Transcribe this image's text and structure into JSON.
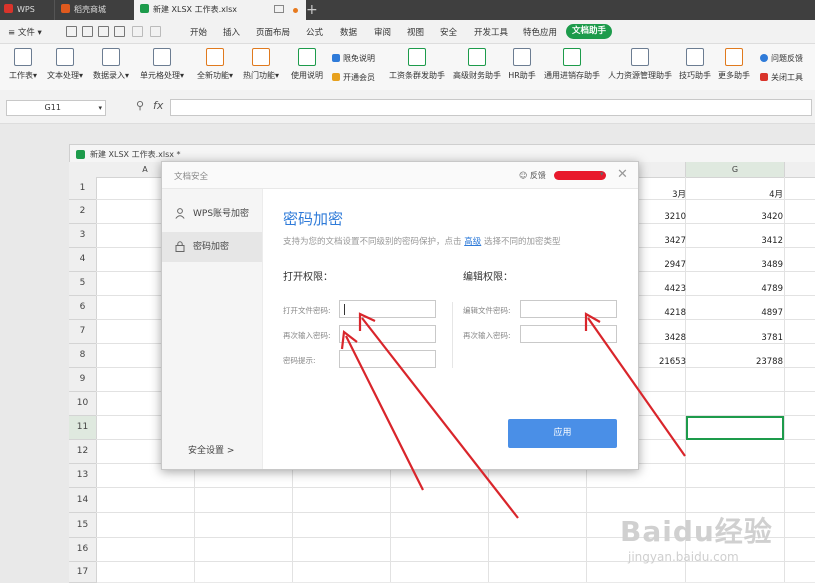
{
  "titlebar": {
    "tabs": [
      {
        "label": "WPS"
      },
      {
        "label": "稻壳商城"
      },
      {
        "label": "新建 XLSX 工作表.xlsx"
      }
    ],
    "new_tab_label": "+"
  },
  "menubar": {
    "file_label": "文件",
    "items": [
      "开始",
      "插入",
      "页面布局",
      "公式",
      "数据",
      "审阅",
      "视图",
      "安全",
      "开发工具",
      "特色应用"
    ],
    "active_item": "文档助手"
  },
  "ribbon": {
    "groups": [
      "工作表",
      "文本处理",
      "数据录入",
      "单元格处理",
      "全新功能",
      "热门功能",
      "使用说明"
    ],
    "small_items": [
      "限免说明",
      "开通会员"
    ],
    "assistants": [
      "工资条群发助手",
      "高级财务助手",
      "HR助手",
      "通用进销存助手",
      "人力资源管理助手",
      "技巧助手",
      "更多助手"
    ],
    "right_items": [
      "问题反馈",
      "关闭工具"
    ]
  },
  "formula_bar": {
    "cell_ref": "G11",
    "fx_label": "fx",
    "formula": ""
  },
  "workbook": {
    "title": "新建 XLSX 工作表.xlsx *",
    "columns": [
      "A",
      "G"
    ],
    "rows": [
      "1",
      "2",
      "3",
      "4",
      "5",
      "6",
      "7",
      "8",
      "9",
      "10",
      "11",
      "12",
      "13",
      "14",
      "15",
      "16",
      "17"
    ],
    "headers": {
      "f": "3月",
      "g": "4月"
    },
    "col_f_values": [
      "3210",
      "3427",
      "2947",
      "4423",
      "4218",
      "3428",
      "21653"
    ],
    "col_g_values": [
      "3420",
      "3412",
      "3489",
      "4789",
      "4897",
      "3781",
      "23788"
    ]
  },
  "dialog": {
    "title": "文档安全",
    "feedback_label": "反馈",
    "sidebar": {
      "items": [
        {
          "label": "WPS账号加密",
          "icon": "user-icon"
        },
        {
          "label": "密码加密",
          "icon": "lock-icon"
        }
      ],
      "settings_label": "安全设置 >"
    },
    "heading": "密码加密",
    "description_prefix": "支持为您的文档设置不同级别的密码保护，点击",
    "description_link": "高级",
    "description_suffix": "选择不同的加密类型",
    "open_section": {
      "title": "打开权限：",
      "fields": [
        "打开文件密码:",
        "再次输入密码:",
        "密码提示:"
      ]
    },
    "edit_section": {
      "title": "编辑权限：",
      "fields": [
        "编辑文件密码:",
        "再次输入密码:"
      ]
    },
    "apply_label": "应用"
  },
  "watermark": {
    "main": "Baidu经验",
    "sub": "jingyan.baidu.com"
  },
  "colors": {
    "accent_green": "#1d9b4b",
    "dialog_blue": "#2f7bd9",
    "apply_blue": "#4a8fe7",
    "arrow_red": "#d9252b"
  }
}
